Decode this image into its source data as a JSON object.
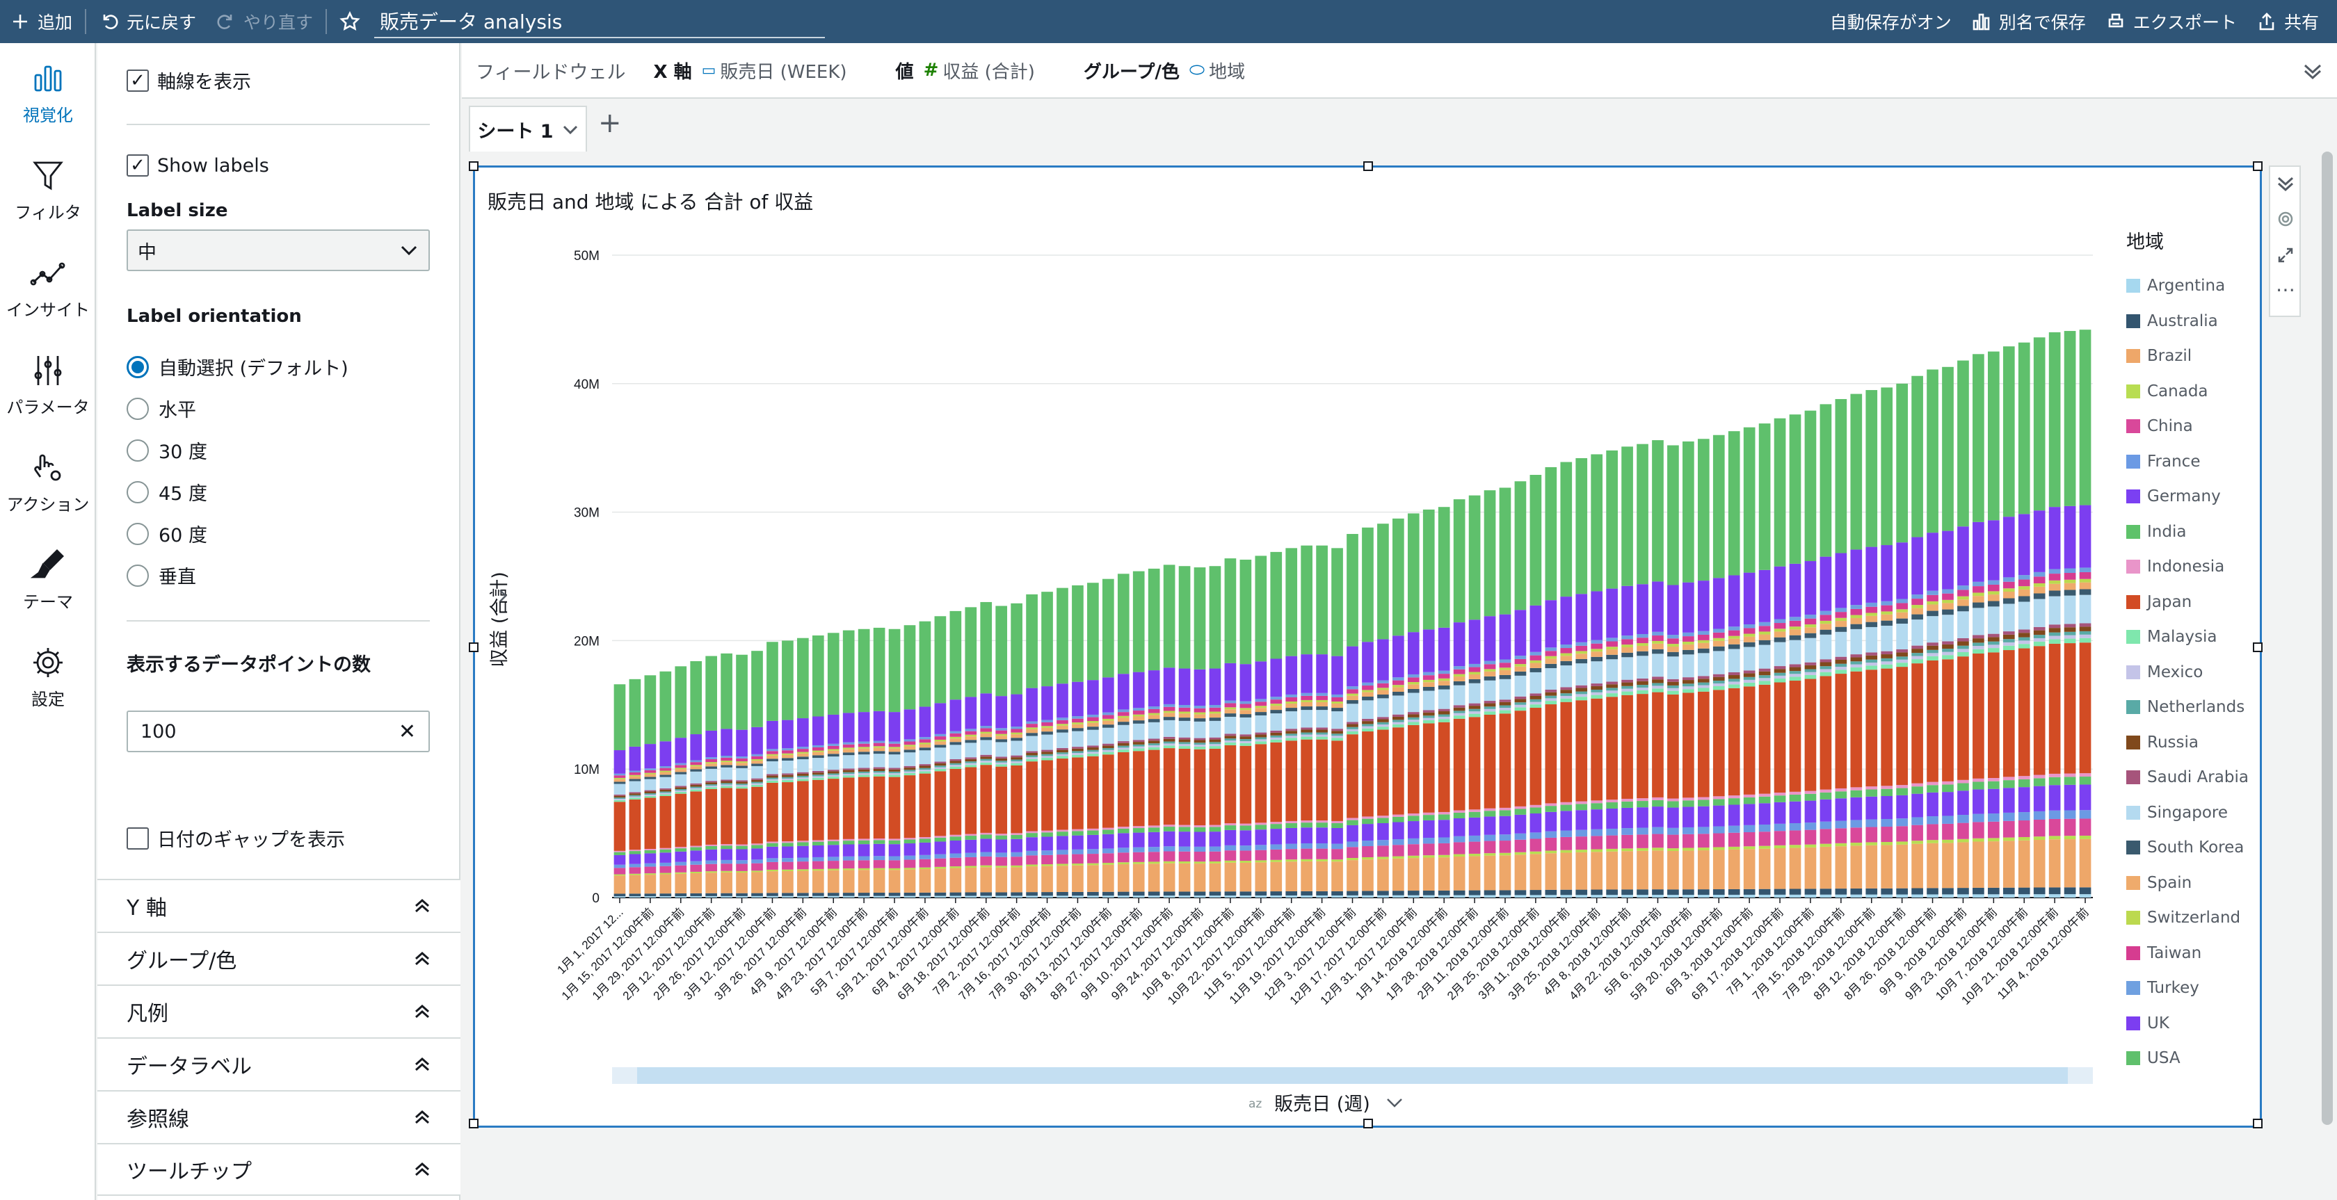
{
  "topbar": {
    "add": "追加",
    "undo": "元に戻す",
    "redo": "やり直す",
    "analysis_name": "販売データ analysis",
    "autosave": "自動保存がオン",
    "save_as": "別名で保存",
    "export": "エクスポート",
    "share": "共有"
  },
  "nav": [
    "視覚化",
    "フィルタ",
    "インサイト",
    "パラメータ",
    "アクション",
    "テーマ",
    "設定"
  ],
  "panel": {
    "show_axis": "軸線を表示",
    "show_labels": "Show labels",
    "label_size": "Label size",
    "label_size_value": "中",
    "label_orientation": "Label orientation",
    "orientations": [
      "自動選択 (デフォルト)",
      "水平",
      "30 度",
      "45 度",
      "60 度",
      "垂直"
    ],
    "datapoints_label": "表示するデータポイントの数",
    "datapoints_value": "100",
    "show_gaps": "日付のギャップを表示",
    "sections": [
      "Y 軸",
      "グループ/色",
      "凡例",
      "データラベル",
      "参照線",
      "ツールチップ"
    ]
  },
  "fieldwell": {
    "title": "フィールドウェル",
    "x_key": "X 軸",
    "x_val": "販売日 (WEEK)",
    "value_key": "値",
    "value_val": "収益 (合計)",
    "group_key": "グループ/色",
    "group_val": "地域"
  },
  "sheet": {
    "tab": "シート 1"
  },
  "visual": {
    "title": "販売日 and 地域 による 合計 of 収益",
    "x_title": "販売日 (週)",
    "y_title": "収益 (合計)",
    "legend_title": "地域"
  },
  "chart_data": {
    "type": "bar",
    "stacked": true,
    "title": "販売日 and 地域 による 合計 of 収益",
    "xlabel": "販売日 (週)",
    "ylabel": "収益 (合計)",
    "ylim": [
      0,
      50000000
    ],
    "yticks": [
      "0",
      "10M",
      "20M",
      "30M",
      "40M",
      "50M"
    ],
    "grid": true,
    "legend_placement": "right",
    "legend_title": "地域",
    "regions": [
      {
        "name": "Argentina",
        "color": "#a6d8ef"
      },
      {
        "name": "Australia",
        "color": "#33556f"
      },
      {
        "name": "Brazil",
        "color": "#eea769"
      },
      {
        "name": "Canada",
        "color": "#b8dd52"
      },
      {
        "name": "China",
        "color": "#d9489a"
      },
      {
        "name": "France",
        "color": "#6b9ae4"
      },
      {
        "name": "Germany",
        "color": "#7b40f2"
      },
      {
        "name": "India",
        "color": "#5ec26a"
      },
      {
        "name": "Indonesia",
        "color": "#e995c9"
      },
      {
        "name": "Japan",
        "color": "#d24c24"
      },
      {
        "name": "Malaysia",
        "color": "#7fe7ad"
      },
      {
        "name": "Mexico",
        "color": "#c4c4e8"
      },
      {
        "name": "Netherlands",
        "color": "#59aaa6"
      },
      {
        "name": "Russia",
        "color": "#80491c"
      },
      {
        "name": "Saudi Arabia",
        "color": "#a6547b"
      },
      {
        "name": "Singapore",
        "color": "#b4daf0"
      },
      {
        "name": "South Korea",
        "color": "#3a5a6e"
      },
      {
        "name": "Spain",
        "color": "#efab6c"
      },
      {
        "name": "Switzerland",
        "color": "#bcd94f"
      },
      {
        "name": "Taiwan",
        "color": "#d63c90"
      },
      {
        "name": "Turkey",
        "color": "#6fa0e0"
      },
      {
        "name": "UK",
        "color": "#7c3ef0"
      },
      {
        "name": "USA",
        "color": "#5fc06c"
      }
    ],
    "x_tick_labels": [
      "1月 1, 2017 12...",
      "1月 15, 2017 12:00午前",
      "1月 29, 2017 12:00午前",
      "2月 12, 2017 12:00午前",
      "2月 26, 2017 12:00午前",
      "3月 12, 2017 12:00午前",
      "3月 26, 2017 12:00午前",
      "4月 9, 2017 12:00午前",
      "4月 23, 2017 12:00午前",
      "5月 7, 2017 12:00午前",
      "5月 21, 2017 12:00午前",
      "6月 4, 2017 12:00午前",
      "6月 18, 2017 12:00午前",
      "7月 2, 2017 12:00午前",
      "7月 16, 2017 12:00午前",
      "7月 30, 2017 12:00午前",
      "8月 13, 2017 12:00午前",
      "8月 27, 2017 12:00午前",
      "9月 10, 2017 12:00午前",
      "9月 24, 2017 12:00午前",
      "10月 8, 2017 12:00午前",
      "10月 22, 2017 12:00午前",
      "11月 5, 2017 12:00午前",
      "11月 19, 2017 12:00午前",
      "12月 3, 2017 12:00午前",
      "12月 17, 2017 12:00午前",
      "12月 31, 2017 12:00午前",
      "1月 14, 2018 12:00午前",
      "1月 28, 2018 12:00午前",
      "2月 11, 2018 12:00午前",
      "2月 25, 2018 12:00午前",
      "3月 11, 2018 12:00午前",
      "3月 25, 2018 12:00午前",
      "4月 8, 2018 12:00午前",
      "4月 22, 2018 12:00午前",
      "5月 6, 2018 12:00午前",
      "5月 20, 2018 12:00午前",
      "6月 3, 2018 12:00午前",
      "6月 17, 2018 12:00午前",
      "7月 1, 2018 12:00午前",
      "7月 15, 2018 12:00午前",
      "7月 29, 2018 12:00午前",
      "8月 12, 2018 12:00午前",
      "8月 26, 2018 12:00午前",
      "9月 9, 2018 12:00午前",
      "9月 23, 2018 12:00午前",
      "10月 7, 2018 12:00午前",
      "10月 21, 2018 12:00午前",
      "11月 4, 2018 12:00午前"
    ],
    "weeks_count": 97,
    "totals_M": [
      16.6,
      17.0,
      17.3,
      17.6,
      18.0,
      18.4,
      18.8,
      19.0,
      18.9,
      19.2,
      19.9,
      20.0,
      20.2,
      20.4,
      20.6,
      20.8,
      20.9,
      21.0,
      20.9,
      21.2,
      21.5,
      21.9,
      22.3,
      22.6,
      23.0,
      22.7,
      22.9,
      23.6,
      23.8,
      24.1,
      24.3,
      24.5,
      24.8,
      25.2,
      25.4,
      25.6,
      25.9,
      25.8,
      25.7,
      25.8,
      26.4,
      26.3,
      26.6,
      26.9,
      27.2,
      27.4,
      27.4,
      27.2,
      28.3,
      28.8,
      29.1,
      29.5,
      29.9,
      30.2,
      30.4,
      31.0,
      31.3,
      31.7,
      31.9,
      32.4,
      32.9,
      33.5,
      33.9,
      34.2,
      34.5,
      34.8,
      35.1,
      35.3,
      35.6,
      35.2,
      35.5,
      35.7,
      36.0,
      36.3,
      36.6,
      36.9,
      37.3,
      37.6,
      37.9,
      38.4,
      38.8,
      39.2,
      39.5,
      39.7,
      40.0,
      40.6,
      41.1,
      41.3,
      41.8,
      42.3,
      42.5,
      42.9,
      43.2,
      43.6,
      44.0,
      44.1,
      44.2
    ],
    "region_shares": [
      0.006,
      0.012,
      0.085,
      0.006,
      0.03,
      0.015,
      0.045,
      0.014,
      0.006,
      0.23,
      0.008,
      0.006,
      0.006,
      0.008,
      0.006,
      0.05,
      0.01,
      0.012,
      0.006,
      0.012,
      0.008,
      0.11,
      0.309
    ]
  }
}
